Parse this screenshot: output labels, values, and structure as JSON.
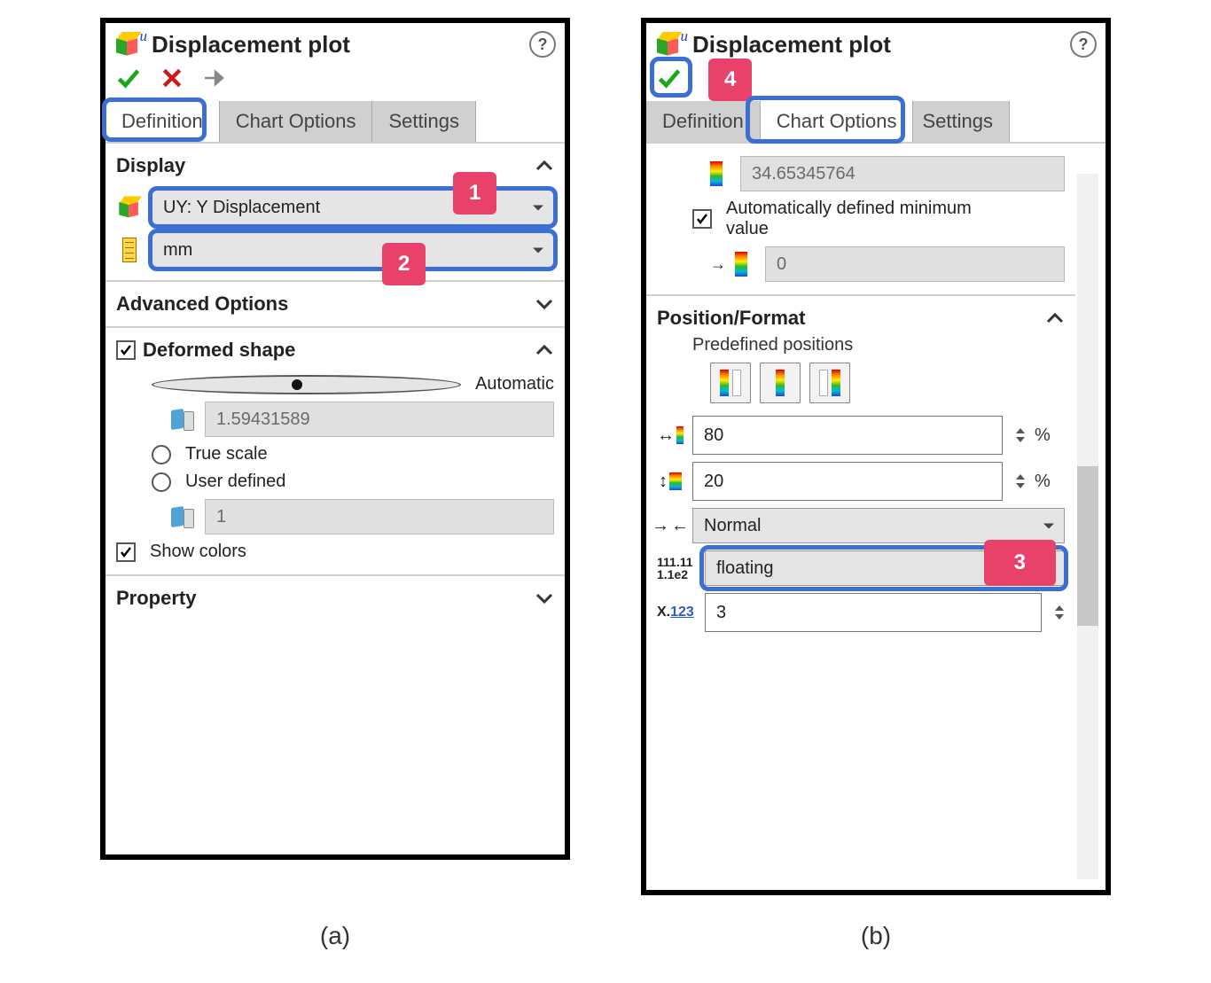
{
  "left": {
    "title": "Displacement plot",
    "tabs": {
      "definition": "Definition",
      "chart": "Chart Options",
      "settings": "Settings"
    },
    "display": {
      "hdr": "Display",
      "component": "UY: Y Displacement",
      "unit": "mm"
    },
    "advanced": {
      "hdr": "Advanced Options"
    },
    "deformed": {
      "hdr": "Deformed shape",
      "auto": "Automatic",
      "auto_value": "1.59431589",
      "true_scale": "True scale",
      "user_defined": "User defined",
      "user_value": "1",
      "show_colors": "Show colors"
    },
    "property": {
      "hdr": "Property"
    },
    "badges": {
      "b1": "1",
      "b2": "2"
    },
    "caption": "(a)"
  },
  "right": {
    "title": "Displacement plot",
    "tabs": {
      "definition": "Definition",
      "chart": "Chart Options",
      "settings": "Settings"
    },
    "auto_min": {
      "max_readonly": "34.65345764",
      "label": "Automatically defined minimum value",
      "min_readonly": "0"
    },
    "posfmt": {
      "hdr": "Position/Format",
      "predef": "Predefined positions",
      "hpos": "80",
      "vpos": "20",
      "pct": "%",
      "thickness": "Normal",
      "numfmt": "floating",
      "decimals": "3"
    },
    "badges": {
      "b3": "3",
      "b4": "4"
    },
    "caption": "(b)"
  }
}
